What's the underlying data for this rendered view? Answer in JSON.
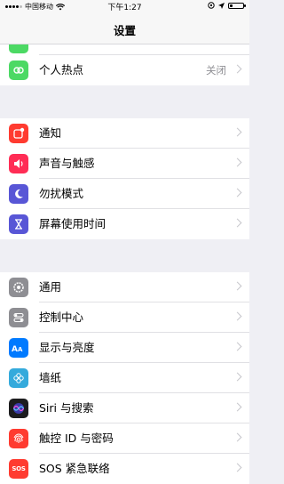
{
  "status_bar": {
    "carrier": "中国移动",
    "time": "下午1:27"
  },
  "nav": {
    "title": "设置"
  },
  "group1": {
    "items": [
      {
        "label": "个人热点",
        "value": "关闭",
        "icon": "hotspot-icon",
        "color": "#4cd964"
      }
    ]
  },
  "group2": {
    "items": [
      {
        "label": "通知",
        "icon": "notifications-icon",
        "color": "#ff3b30"
      },
      {
        "label": "声音与触感",
        "icon": "speaker-icon",
        "color": "#ff2d55"
      },
      {
        "label": "勿扰模式",
        "icon": "moon-icon",
        "color": "#5856d6"
      },
      {
        "label": "屏幕使用时间",
        "icon": "hourglass-icon",
        "color": "#5856d6"
      }
    ]
  },
  "group3": {
    "items": [
      {
        "label": "通用",
        "icon": "gear-icon",
        "color": "#8e8e93"
      },
      {
        "label": "控制中心",
        "icon": "toggles-icon",
        "color": "#8e8e93"
      },
      {
        "label": "显示与亮度",
        "icon": "text-size-icon",
        "color": "#007aff"
      },
      {
        "label": "墙纸",
        "icon": "flower-icon",
        "color": "#34aadc"
      },
      {
        "label": "Siri 与搜索",
        "icon": "siri-icon",
        "color": "#1c1c1e"
      },
      {
        "label": "触控 ID 与密码",
        "icon": "fingerprint-icon",
        "color": "#ff3b30"
      },
      {
        "label": "SOS 紧急联络",
        "icon": "sos-icon",
        "color": "#ff3b30"
      }
    ]
  }
}
